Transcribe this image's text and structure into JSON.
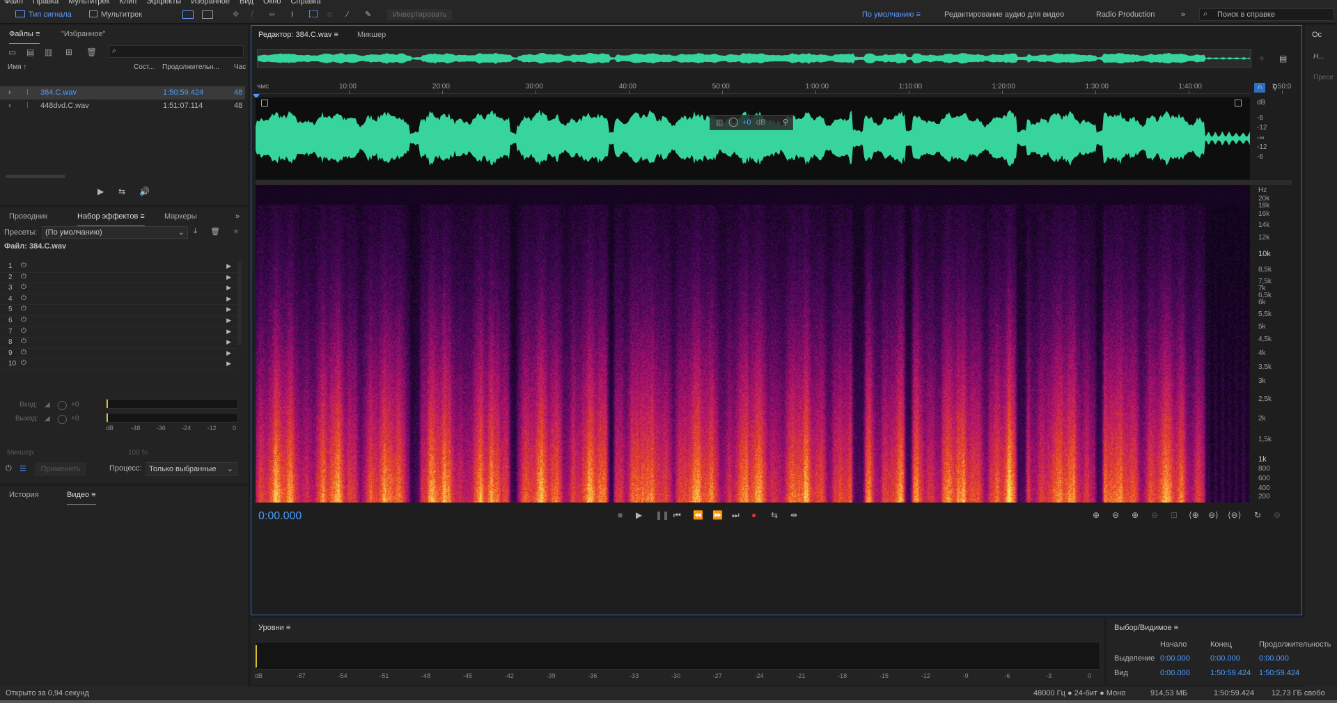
{
  "menu": [
    "Файл",
    "Правка",
    "Мультитрек",
    "Клип",
    "Эффекты",
    "Избранное",
    "Вид",
    "Окно",
    "Справка"
  ],
  "toolbar": {
    "waveform_label": "Тип сигнала",
    "multitrack_label": "Мультитрек",
    "invert_label": "Инвертировать",
    "workspace_default": "По умолчанию",
    "workspace_video": "Редактирование аудио для видео",
    "workspace_radio": "Radio Production",
    "search_placeholder": "Поиск в справке"
  },
  "files_panel": {
    "tab_files": "Файлы",
    "tab_favorites": "\"Избранное\"",
    "col_name": "Имя",
    "col_status": "Сост...",
    "col_duration": "Продолжительн...",
    "col_rate": "Час",
    "files": [
      {
        "name": "384.C.wav",
        "duration": "1:50:59.424",
        "rate": "48"
      },
      {
        "name": "448dvd.C.wav",
        "duration": "1:51:07.114",
        "rate": "48"
      }
    ]
  },
  "effects_panel": {
    "tab_explorer": "Проводник",
    "tab_effects": "Набор эффектов",
    "tab_markers": "Маркеры",
    "presets_label": "Пресеты:",
    "presets_value": "(По умолчанию)",
    "file_label": "Файл: 384.C.wav",
    "slots": [
      "1",
      "2",
      "3",
      "4",
      "5",
      "6",
      "7",
      "8",
      "9",
      "10"
    ],
    "input_label": "Вход:",
    "output_label": "Выход:",
    "input_val": "+0",
    "output_val": "+0",
    "meter_ticks": [
      "dB",
      "-48",
      "-36",
      "-24",
      "-12",
      "0"
    ],
    "mixer_label": "Микшер:",
    "mixer_val": "100 %",
    "apply_label": "Применить",
    "process_label": "Процесс:",
    "process_value": "Только выбранные"
  },
  "history_panel": {
    "tab_history": "История",
    "tab_video": "Видео"
  },
  "editor": {
    "title": "Редактор: 384.C.wav",
    "tab_mixer": "Микшер",
    "ruler_start": "чмс",
    "ruler": [
      "10:00",
      "20:00",
      "30:00",
      "40:00",
      "50:00",
      "1:00:00",
      "1:10:00",
      "1:20:00",
      "1:30:00",
      "1:40:00",
      "1:50:0"
    ],
    "hud_gain": "+0",
    "hud_unit": "dB",
    "db_labels": [
      "dB",
      "-6",
      "-12",
      "-∞",
      "-12",
      "-6"
    ],
    "hz_labels": [
      "Hz",
      "20k",
      "18k",
      "16k",
      "14k",
      "12k",
      "10k",
      "8,5k",
      "7,5k",
      "7k",
      "6,5k",
      "6k",
      "5,5k",
      "5k",
      "4,5k",
      "4k",
      "3,5k",
      "3k",
      "2,5k",
      "2k",
      "1,5k",
      "1k",
      "800",
      "600",
      "400",
      "200"
    ],
    "time_display": "0:00.000"
  },
  "levels_panel": {
    "title": "Уровни",
    "ticks": [
      "dB",
      "-57",
      "-54",
      "-51",
      "-48",
      "-45",
      "-42",
      "-39",
      "-36",
      "-33",
      "-30",
      "-27",
      "-24",
      "-21",
      "-18",
      "-15",
      "-12",
      "-9",
      "-6",
      "-3",
      "0"
    ]
  },
  "selection_panel": {
    "title": "Выбор/Видимое",
    "col_start": "Начало",
    "col_end": "Конец",
    "col_duration": "Продолжительность",
    "row_selection": "Выделение",
    "row_view": "Вид",
    "sel_start": "0:00.000",
    "sel_end": "0:00.000",
    "sel_duration": "0:00.000",
    "view_start": "0:00.000",
    "view_end": "1:50:59.424",
    "view_duration": "1:50:59.424"
  },
  "right_strip": {
    "tab": "Ос",
    "item1": "Н...",
    "item2": "Пресе"
  },
  "status": {
    "left": "Открыто за 0,94 секунд",
    "format": "48000 Гц ● 24-бит ● Моно",
    "size": "914,53 МБ",
    "duration": "1:50:59.424",
    "free": "12,73 ГБ свобо"
  },
  "colors": {
    "accent": "#4d9cff",
    "waveform": "#37d49b",
    "record": "#e03030"
  }
}
